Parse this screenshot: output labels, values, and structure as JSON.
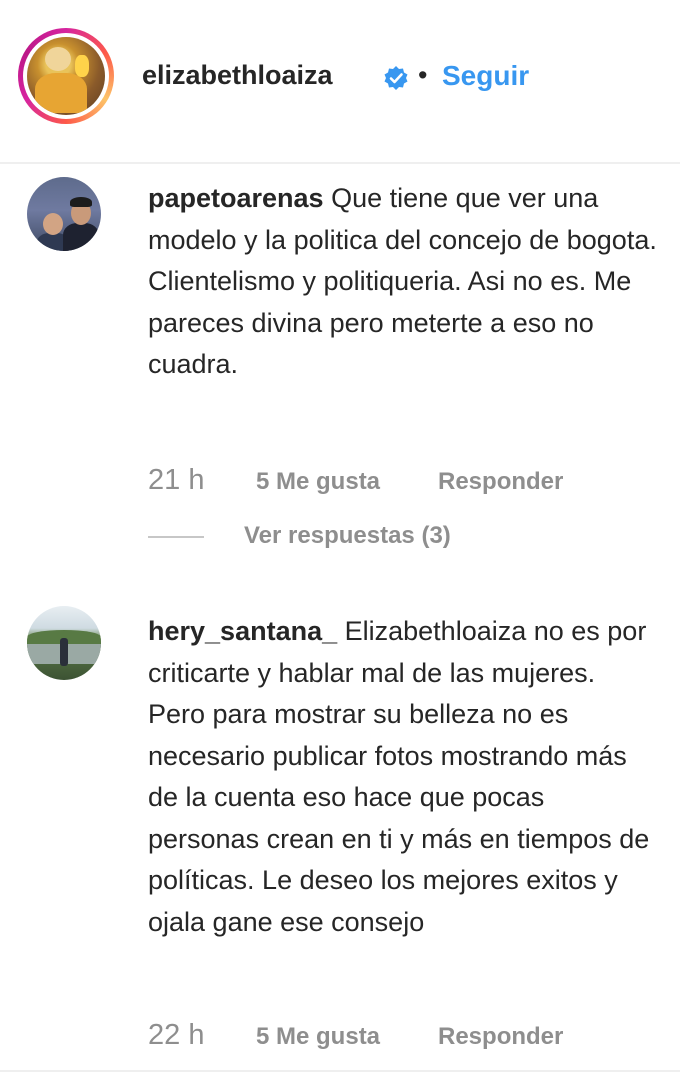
{
  "header": {
    "username": "elizabethloaiza",
    "separator": "•",
    "follow_label": "Seguir"
  },
  "comments": [
    {
      "username": "papetoarenas",
      "text": "Que tiene que ver una modelo y la politica del concejo de bogota. Clientelismo y politiqueria. Asi no es. Me pareces divina pero meterte a eso no cuadra.",
      "time": "21 h",
      "likes": "5 Me gusta",
      "reply_label": "Responder",
      "view_replies": "Ver respuestas (3)"
    },
    {
      "username": "hery_santana_",
      "text": "Elizabethloaiza no es por criticarte y hablar mal de las mujeres. Pero para mostrar su belleza no es necesario publicar fotos mostrando más de la cuenta eso hace que pocas personas crean en ti y más en tiempos de políticas. Le deseo los mejores exitos y ojala gane ese consejo",
      "time": "22 h",
      "likes": "5 Me gusta",
      "reply_label": "Responder"
    }
  ],
  "colors": {
    "link": "#3897f0",
    "muted": "#8e8e8e",
    "text": "#262626",
    "verified": "#3897f0"
  },
  "icons": {
    "verified": "verified-badge-icon"
  }
}
